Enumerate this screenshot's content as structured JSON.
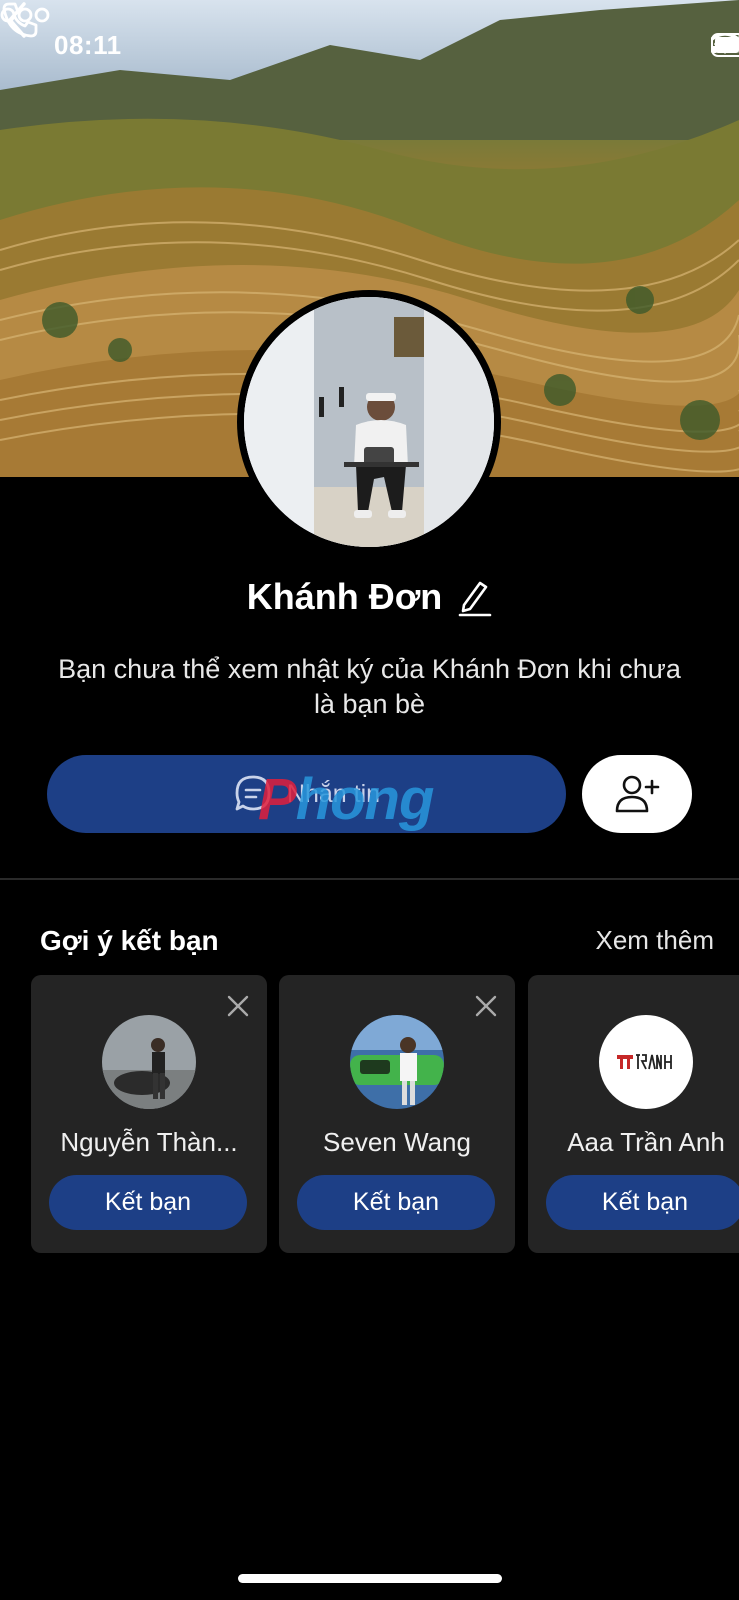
{
  "status": {
    "time": "08:11"
  },
  "profile": {
    "name": "Khánh Đơn",
    "note": "Bạn chưa thể xem nhật ký của Khánh Đơn khi chưa là bạn bè",
    "message_label": "Nhắn tin",
    "watermark_part1": "P",
    "watermark_part2": "hong"
  },
  "suggestions": {
    "title": "Gợi ý kết bạn",
    "see_more": "Xem thêm",
    "items": [
      {
        "name": "Nguyễn Thàn...",
        "button": "Kết bạn"
      },
      {
        "name": "Seven Wang",
        "button": "Kết bạn"
      },
      {
        "name": "Aaa Trần Anh",
        "button": "Kết bạn",
        "logo_text": "TRẦN ANH"
      }
    ]
  },
  "colors": {
    "primary_button": "#1d3f86",
    "card_bg": "#242424"
  }
}
